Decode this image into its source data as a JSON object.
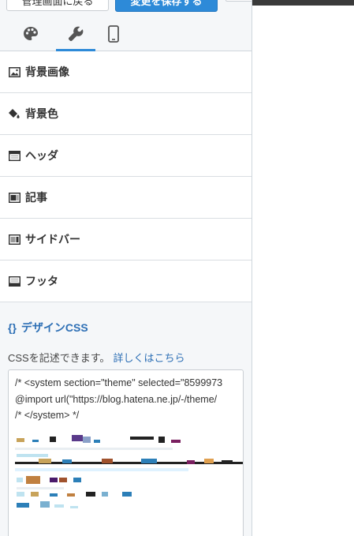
{
  "header": {
    "back_label": "管理画面に戻る",
    "save_label": "変更を保存する"
  },
  "tabs": [
    {
      "name": "palette-icon",
      "active": false
    },
    {
      "name": "wrench-icon",
      "active": true
    },
    {
      "name": "smartphone-icon",
      "active": false
    }
  ],
  "menu": {
    "items": [
      {
        "label": "背景画像",
        "icon": "image-icon"
      },
      {
        "label": "背景色",
        "icon": "paint-bucket-icon"
      },
      {
        "label": "ヘッダ",
        "icon": "header-layout-icon"
      },
      {
        "label": "記事",
        "icon": "article-layout-icon"
      },
      {
        "label": "サイドバー",
        "icon": "sidebar-layout-icon"
      },
      {
        "label": "フッタ",
        "icon": "footer-layout-icon"
      }
    ]
  },
  "css": {
    "title_icon": "{}",
    "title": "デザインCSS",
    "description": "CSSを記述できます。",
    "link": "詳しくはこちら",
    "code_lines": [
      "/* <system section=\"theme\" selected=\"8599973",
      "@import url(\"https://blog.hatena.ne.jp/-/theme/",
      "/* </system> */"
    ]
  },
  "colors": {
    "accent": "#2d8ad8",
    "link": "#2d6fb5"
  }
}
